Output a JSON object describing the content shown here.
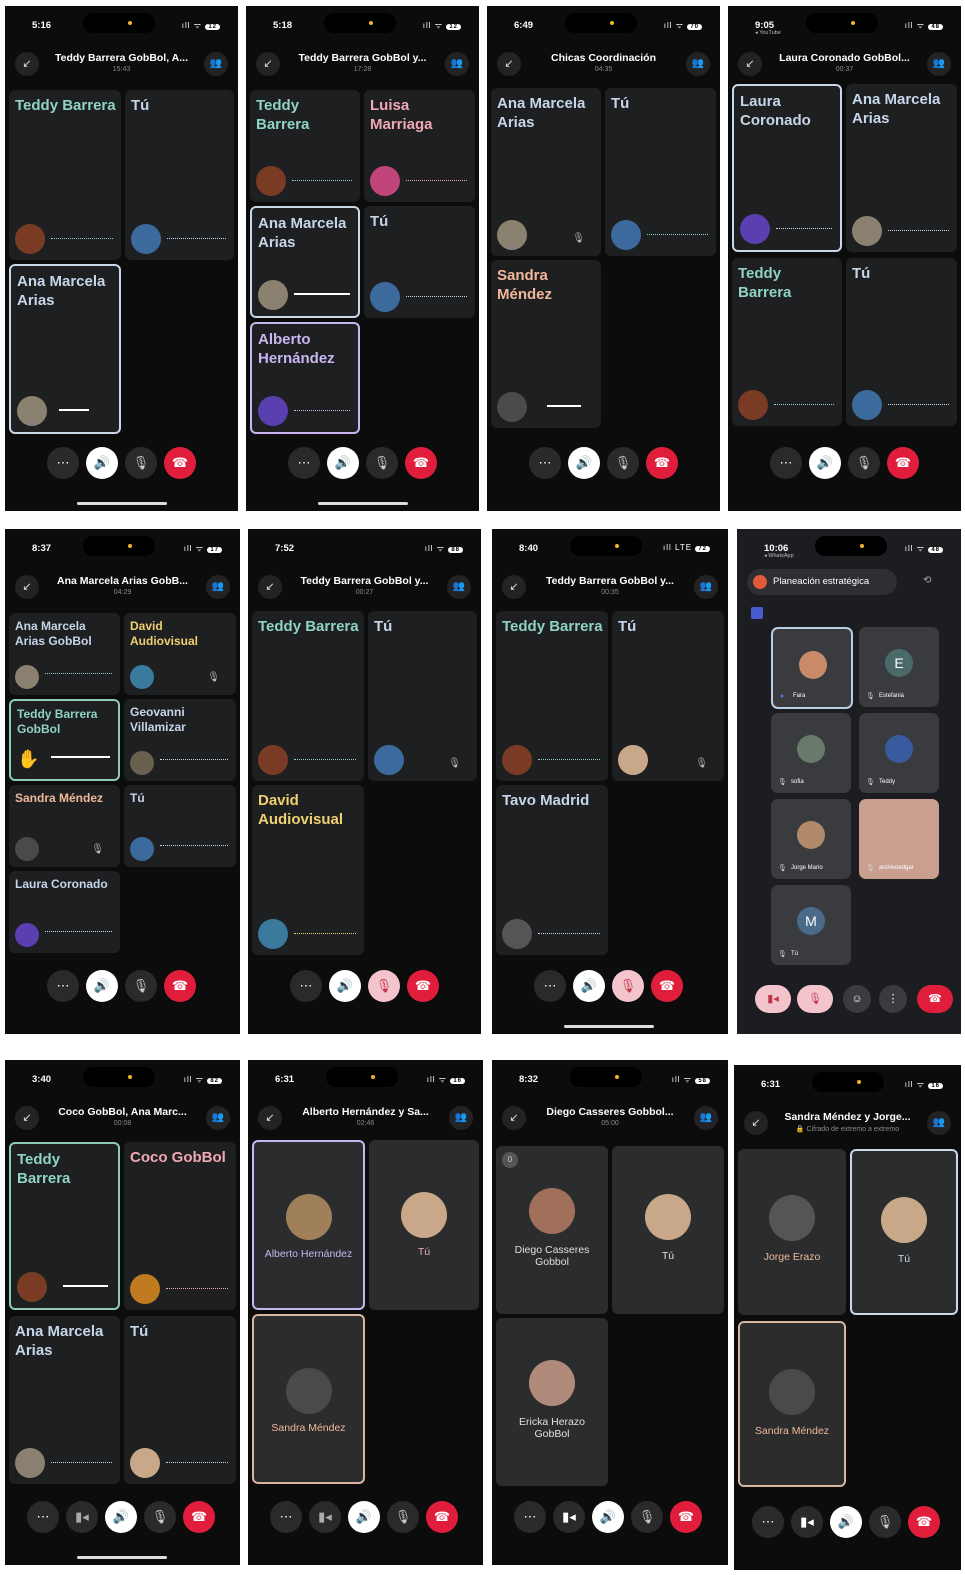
{
  "phones": [
    {
      "time": "5:16",
      "title": "Teddy Barrera GobBol, A...",
      "subtitle": "15:43",
      "battery": "12",
      "tiles": [
        {
          "name": "Teddy Barrera"
        },
        {
          "name": "Tú"
        },
        {
          "name": "Ana Marcela Arias"
        }
      ]
    },
    {
      "time": "5:18",
      "title": "Teddy Barrera GobBol y...",
      "subtitle": "17:28",
      "battery": "12",
      "tiles": [
        {
          "name": "Teddy Barrera"
        },
        {
          "name": "Luisa Marriaga"
        },
        {
          "name": "Ana Marcela Arias"
        },
        {
          "name": "Tú"
        },
        {
          "name": "Alberto Hernández"
        }
      ]
    },
    {
      "time": "6:49",
      "title": "Chicas Coordinación",
      "subtitle": "04:35",
      "battery": "70",
      "tiles": [
        {
          "name": "Ana Marcela Arias"
        },
        {
          "name": "Tú"
        },
        {
          "name": "Sandra Méndez"
        }
      ]
    },
    {
      "time": "9:05",
      "back": "◂ YouTube",
      "title": "Laura Coronado GobBol...",
      "subtitle": "00:37",
      "battery": "48",
      "tiles": [
        {
          "name": "Laura Coronado"
        },
        {
          "name": "Ana Marcela Arias"
        },
        {
          "name": "Teddy Barrera"
        },
        {
          "name": "Tú"
        }
      ]
    },
    {
      "time": "8:37",
      "title": "Ana Marcela Arias GobB...",
      "subtitle": "04:29",
      "battery": "17",
      "tiles": [
        {
          "name": "Ana Marcela Arias GobBol"
        },
        {
          "name": "David Audiovisual"
        },
        {
          "name": "Teddy Barrera GobBol"
        },
        {
          "name": "Geovanni Villamizar"
        },
        {
          "name": "Sandra Méndez"
        },
        {
          "name": "Tú"
        },
        {
          "name": "Laura Coronado"
        }
      ]
    },
    {
      "time": "7:52",
      "title": "Teddy Barrera GobBol y...",
      "subtitle": "00:27",
      "battery": "88",
      "tiles": [
        {
          "name": "Teddy Barrera"
        },
        {
          "name": "Tú"
        },
        {
          "name": "David Audiovisual"
        }
      ]
    },
    {
      "time": "8:40",
      "network": "LTE",
      "title": "Teddy Barrera GobBol y...",
      "subtitle": "00:35",
      "battery": "72",
      "tiles": [
        {
          "name": "Teddy Barrera"
        },
        {
          "name": "Tú"
        },
        {
          "name": "Tavo Madrid"
        }
      ]
    },
    {
      "time": "10:06",
      "back": "◂ WhatsApp",
      "title": "Planeación estratégica",
      "battery": "48",
      "tiles": [
        {
          "name": "Fara"
        },
        {
          "name": "Estefania",
          "initial": "E"
        },
        {
          "name": "sofia"
        },
        {
          "name": "Teddy"
        },
        {
          "name": "Jorge Mario"
        },
        {
          "name": "archivoedgar"
        },
        {
          "name": "Tú",
          "initial": "M"
        }
      ]
    },
    {
      "time": "3:40",
      "title": "Coco GobBol, Ana Marc...",
      "subtitle": "00:08",
      "battery": "82",
      "tiles": [
        {
          "name": "Teddy Barrera"
        },
        {
          "name": "Coco GobBol"
        },
        {
          "name": "Ana Marcela Arias"
        },
        {
          "name": "Tú"
        }
      ]
    },
    {
      "time": "6:31",
      "title": "Alberto Hernández y Sa...",
      "subtitle": "02:46",
      "battery": "16",
      "tiles": [
        {
          "name": "Alberto Hernández"
        },
        {
          "name": "Tú"
        },
        {
          "name": "Sandra Méndez"
        }
      ]
    },
    {
      "time": "8:32",
      "title": "Diego Casseres Gobbol...",
      "subtitle": "05:00",
      "battery": "58",
      "badge": "0",
      "tiles": [
        {
          "name": "Diego Casseres Gobbol"
        },
        {
          "name": "Tú"
        },
        {
          "name": "Ericka Herazo GobBol"
        }
      ]
    },
    {
      "time": "6:31",
      "title": "Sandra Méndez y Jorge...",
      "subtitle": "Cifrado de extremo a extremo",
      "battery": "16",
      "tiles": [
        {
          "name": "Jorge Erazo"
        },
        {
          "name": "Tú"
        },
        {
          "name": "Sandra Méndez"
        }
      ]
    }
  ],
  "icons": {
    "more": "⋯",
    "speaker": "🔊",
    "mic": "🎙",
    "end": "☎",
    "video": "▮◂",
    "minimize": "↙",
    "people": "👥",
    "lock": "🔒"
  },
  "colors": {
    "end_call": "#e01e3c",
    "teal_name": "#8fd3c5",
    "pink_name": "#f0a8b4",
    "blue_name": "#c6d6ea",
    "orange_name": "#f0b89a",
    "violet_name": "#c9b6f0"
  }
}
